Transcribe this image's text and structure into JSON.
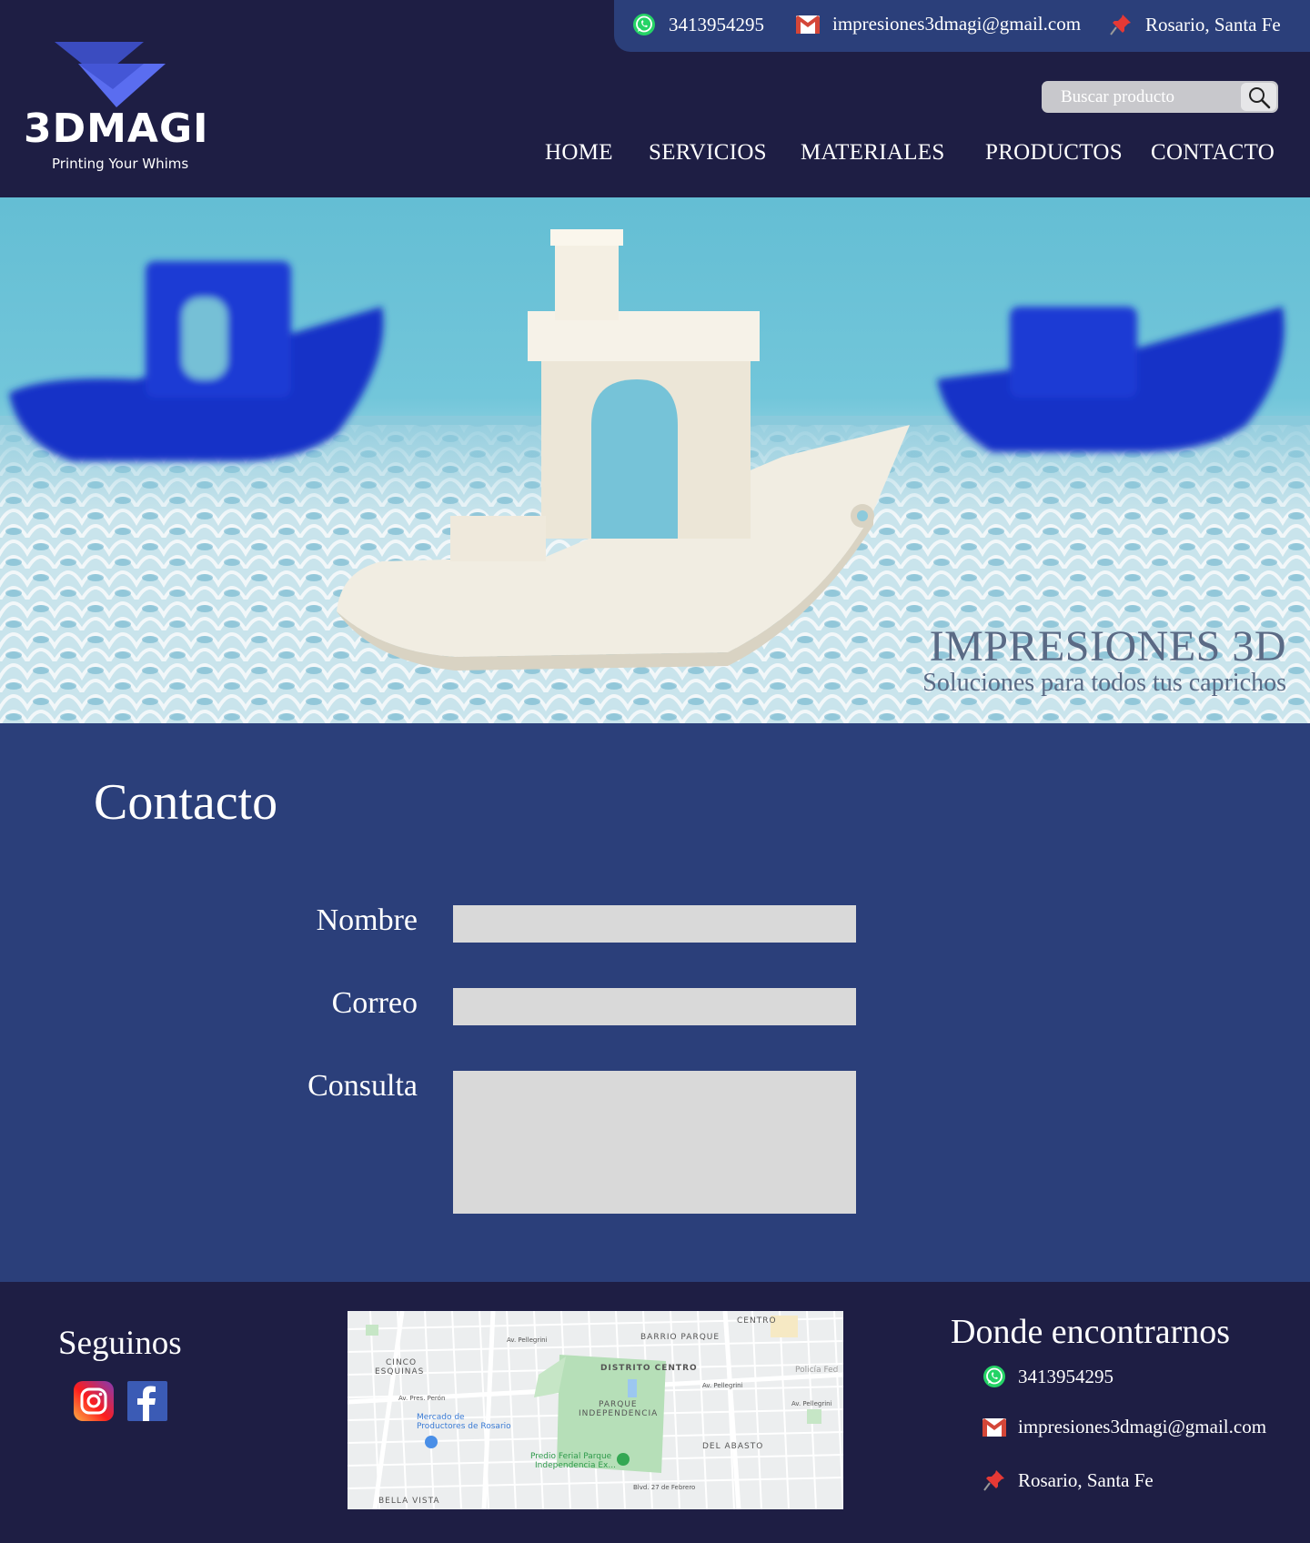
{
  "contact_bar": {
    "phone": "3413954295",
    "email": "impresiones3dmagi@gmail.com",
    "location": "Rosario, Santa Fe"
  },
  "logo": {
    "name": "3DMAGI",
    "tagline": "Printing Your Whims"
  },
  "search": {
    "placeholder": "Buscar producto",
    "icon": "search-icon"
  },
  "nav": {
    "items": [
      {
        "label": "HOME"
      },
      {
        "label": "SERVICIOS"
      },
      {
        "label": "MATERIALES"
      },
      {
        "label": "PRODUCTOS"
      },
      {
        "label": "CONTACTO"
      }
    ]
  },
  "hero": {
    "title": "IMPRESIONES 3D",
    "subtitle": "Soluciones para todos tus caprichos"
  },
  "contact": {
    "title": "Contacto",
    "fields": {
      "name_label": "Nombre",
      "email_label": "Correo",
      "query_label": "Consulta"
    }
  },
  "footer": {
    "follow_title": "Seguinos",
    "social": [
      "instagram-icon",
      "facebook-icon"
    ],
    "map_labels": {
      "centro": "CENTRO",
      "barrio_parque": "BARRIO PARQUE",
      "cinco_esquinas_1": "CINCO",
      "cinco_esquinas_2": "ESQUINAS",
      "distrito_centro": "DISTRITO CENTRO",
      "parque_1": "PARQUE",
      "parque_2": "INDEPENDENCIA",
      "del_abasto": "DEL ABASTO",
      "bella_vista": "BELLA VISTA",
      "mercado_1": "Mercado de",
      "mercado_2": "Productores de Rosario",
      "predio_1": "Predio Ferial Parque",
      "predio_2": "Independencia Ex...",
      "policia": "Policía Fed",
      "pellegrini_1": "Av. Pellegrini",
      "pellegrini_2": "Av. Pellegrini",
      "pellegrini_3": "Av. Pellegrini",
      "peron": "Av. Pres. Perón",
      "febrero": "Blvd. 27 de Febrero"
    },
    "where_title": "Donde encontrarnos",
    "phone": "3413954295",
    "email": "impresiones3dmagi@gmail.com",
    "location": "Rosario, Santa Fe"
  },
  "colors": {
    "header_bg": "#1e1e44",
    "accent_blue": "#2b3f7a",
    "field_bg": "#d9d9d9",
    "whatsapp": "#25d366",
    "gmail": "#d44638",
    "pin": "#e53935"
  }
}
